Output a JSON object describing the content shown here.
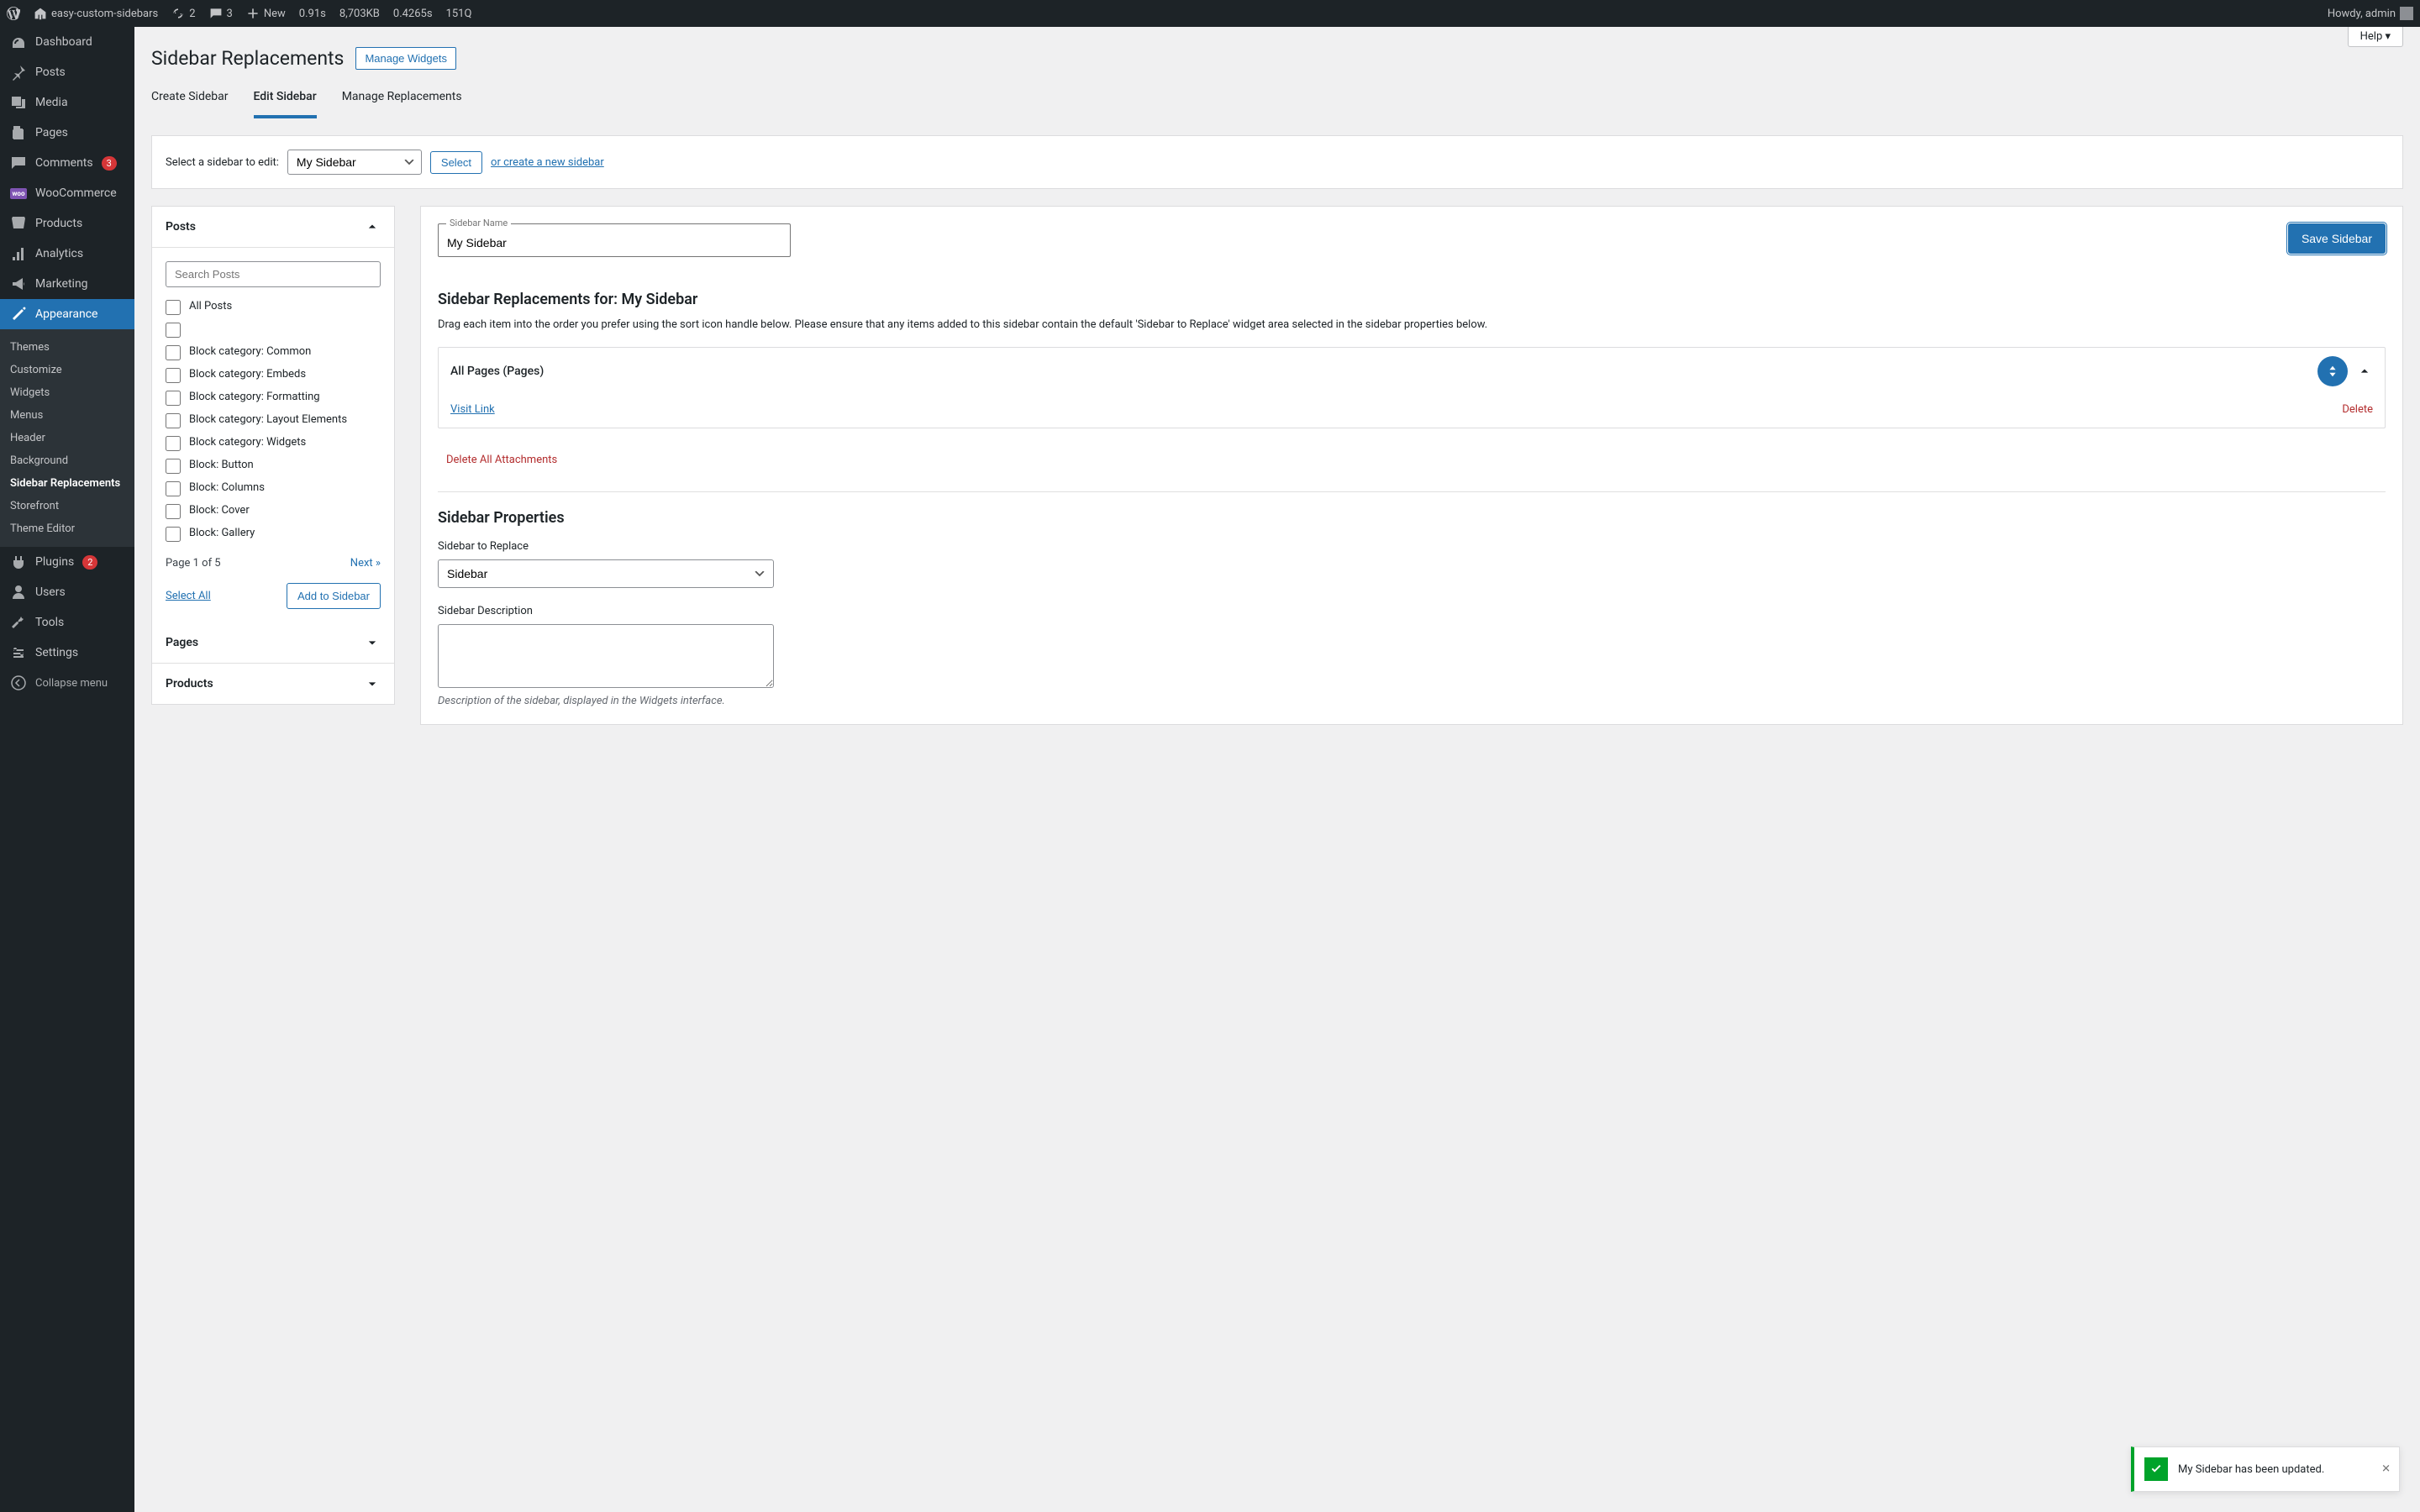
{
  "adminBar": {
    "siteName": "easy-custom-sidebars",
    "updates": "2",
    "comments": "3",
    "new": "New",
    "perf1": "0.91s",
    "perf2": "8,703KB",
    "perf3": "0.4265s",
    "perf4": "151Q",
    "howdy": "Howdy, admin"
  },
  "menu": {
    "dashboard": "Dashboard",
    "posts": "Posts",
    "media": "Media",
    "pages": "Pages",
    "comments": "Comments",
    "commentsBadge": "3",
    "woocommerce": "WooCommerce",
    "products": "Products",
    "analytics": "Analytics",
    "marketing": "Marketing",
    "appearance": "Appearance",
    "plugins": "Plugins",
    "pluginsBadge": "2",
    "users": "Users",
    "tools": "Tools",
    "settings": "Settings",
    "collapse": "Collapse menu"
  },
  "submenu": {
    "themes": "Themes",
    "customize": "Customize",
    "widgets": "Widgets",
    "menus": "Menus",
    "header": "Header",
    "background": "Background",
    "sidebarReplacements": "Sidebar Replacements",
    "storefront": "Storefront",
    "themeEditor": "Theme Editor"
  },
  "header": {
    "help": "Help ▾",
    "title": "Sidebar Replacements",
    "manageWidgets": "Manage Widgets"
  },
  "tabs": {
    "create": "Create Sidebar",
    "edit": "Edit Sidebar",
    "manage": "Manage Replacements"
  },
  "selector": {
    "label": "Select a sidebar to edit:",
    "value": "My Sidebar",
    "selectBtn": "Select",
    "createLink": "or create a new sidebar"
  },
  "postsPanel": {
    "title": "Posts",
    "searchPlaceholder": "Search Posts",
    "items": [
      "All Posts",
      "",
      "Block category: Common",
      "Block category: Embeds",
      "Block category: Formatting",
      "Block category: Layout Elements",
      "Block category: Widgets",
      "Block: Button",
      "Block: Columns",
      "Block: Cover",
      "Block: Gallery"
    ],
    "pageInfo": "Page 1 of 5",
    "next": "Next »",
    "selectAll": "Select All",
    "addBtn": "Add to Sidebar"
  },
  "collapsedPanels": {
    "pages": "Pages",
    "products": "Products"
  },
  "rightPanel": {
    "sidebarNameLabel": "Sidebar Name",
    "sidebarNameValue": "My Sidebar",
    "saveBtn": "Save Sidebar",
    "replacementsHeading": "Sidebar Replacements for: My Sidebar",
    "replacementsDesc": "Drag each item into the order you prefer using the sort icon handle below. Please ensure that any items added to this sidebar contain the default 'Sidebar to Replace' widget area selected in the sidebar properties below.",
    "attachment": {
      "title": "All Pages (Pages)",
      "visitLink": "Visit Link",
      "delete": "Delete"
    },
    "deleteAll": "Delete All Attachments",
    "propsHeading": "Sidebar Properties",
    "replaceLabel": "Sidebar to Replace",
    "replaceValue": "Sidebar",
    "descLabel": "Sidebar Description",
    "descHelp": "Description of the sidebar, displayed in the Widgets interface."
  },
  "toast": {
    "message": "My Sidebar has been updated."
  }
}
